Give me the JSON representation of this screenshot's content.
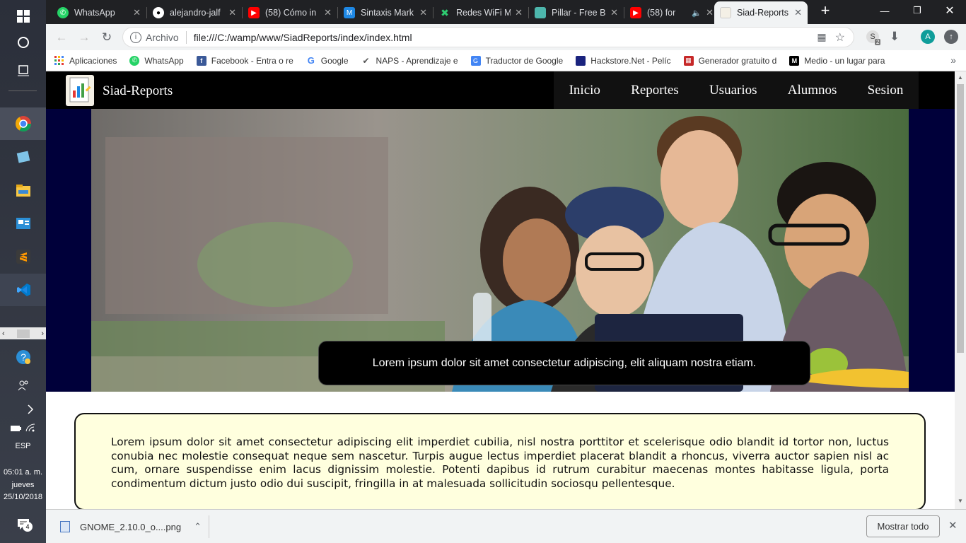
{
  "taskbar": {
    "keyboard_lang": "ESP",
    "clock_time": "05:01 a. m.",
    "clock_day": "jueves",
    "clock_date": "25/10/2018",
    "notification_count": "4"
  },
  "tabs": [
    {
      "title": "WhatsApp",
      "icon": "whatsapp-icon",
      "color": "#25d366"
    },
    {
      "title": "alejandro-jalf",
      "icon": "github-icon",
      "color": "#ffffff"
    },
    {
      "title": "(58) Cómo in",
      "icon": "youtube-icon",
      "color": "#ff0000"
    },
    {
      "title": "Sintaxis Mark",
      "icon": "markdown-icon",
      "color": "#1e88e5"
    },
    {
      "title": "Redes WiFi M",
      "icon": "wifi-icon",
      "color": "#2ecc71"
    },
    {
      "title": "Pillar - Free B",
      "icon": "pillar-icon",
      "color": "#4db6ac"
    },
    {
      "title": "(58) for",
      "icon": "youtube-icon",
      "color": "#ff0000"
    },
    {
      "title": "Siad-Reports",
      "icon": "siad-icon",
      "color": "#f4f0e6"
    }
  ],
  "omnibox": {
    "info_label": "Archivo",
    "url": "file:///C:/wamp/www/SiadReports/index/index.html",
    "profile_initial": "A",
    "extension_badge": "2"
  },
  "bookmarks": [
    {
      "label": "Aplicaciones",
      "icon": "apps-grid-icon",
      "color": "#e53935"
    },
    {
      "label": "WhatsApp",
      "icon": "whatsapp-icon",
      "color": "#25d366"
    },
    {
      "label": "Facebook - Entra o re",
      "icon": "facebook-icon",
      "color": "#3b5998"
    },
    {
      "label": "Google",
      "icon": "google-icon",
      "color": "#ffffff"
    },
    {
      "label": "NAPS - Aprendizaje e",
      "icon": "naps-icon",
      "color": "#9e9e9e"
    },
    {
      "label": "Traductor de Google",
      "icon": "translate-icon",
      "color": "#4285f4"
    },
    {
      "label": "Hackstore.Net - Pelíc",
      "icon": "hackstore-icon",
      "color": "#1a237e"
    },
    {
      "label": "Generador gratuito d",
      "icon": "generator-icon",
      "color": "#c62828"
    },
    {
      "label": "Medio - un lugar para",
      "icon": "medium-icon",
      "color": "#000000"
    }
  ],
  "site": {
    "brand": "Siad-Reports",
    "menu": [
      "Inicio",
      "Reportes",
      "Usuarios",
      "Alumnos",
      "Sesion"
    ],
    "hero_caption": "Lorem ipsum dolor sit amet consectetur adipiscing, elit aliquam nostra etiam.",
    "body_text": "Lorem ipsum dolor sit amet consectetur adipiscing elit imperdiet cubilia, nisl nostra porttitor et scelerisque odio blandit id tortor non, luctus conubia nec molestie consequat neque sem nascetur. Turpis augue lectus imperdiet placerat blandit a rhoncus, viverra auctor sapien nisl ac cum, ornare suspendisse enim lacus dignissim molestie. Potenti dapibus id rutrum curabitur maecenas montes habitasse ligula, porta condimentum dictum justo odio dui suscipit, fringilla in at malesuada sollicitudin sociosqu pellentesque."
  },
  "download": {
    "filename": "GNOME_2.10.0_o....png",
    "show_all": "Mostrar todo"
  }
}
